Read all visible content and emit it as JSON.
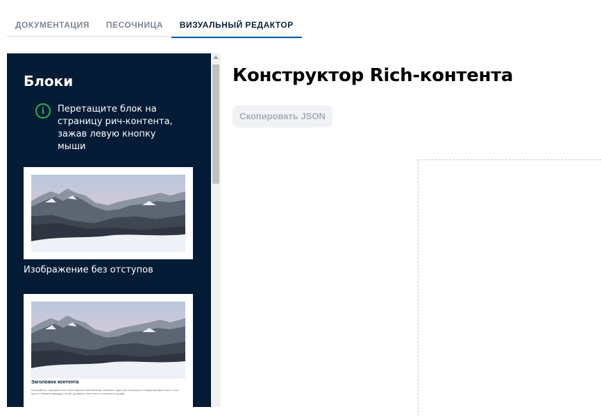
{
  "tabs": [
    {
      "label": "ДОКУМЕНТАЦИЯ",
      "active": false
    },
    {
      "label": "ПЕСОЧНИЦА",
      "active": false
    },
    {
      "label": "ВИЗУАЛЬНЫЙ РЕДАКТОР",
      "active": true
    }
  ],
  "sidebar": {
    "title": "Блоки",
    "hint": "Перетащите блок на страницу рич-контента, зажав левую кнопку мыши",
    "blocks": [
      {
        "label": "Изображение без отступов"
      },
      {
        "heading": "Заголовок контента",
        "text": "Пожалуйста, замените этот текст вашим собственным. Нажмите один раз и выберите «Редактировать текст» или просто нажмите дважды, чтобы добавить свой текст и настроить шрифт."
      }
    ]
  },
  "main": {
    "title": "Конструктор Rich-контента",
    "copy_button": "Скопировать JSON"
  },
  "colors": {
    "sidebar_bg": "#031b35",
    "accent": "#0a63ae",
    "info_green": "#2fb14e"
  }
}
